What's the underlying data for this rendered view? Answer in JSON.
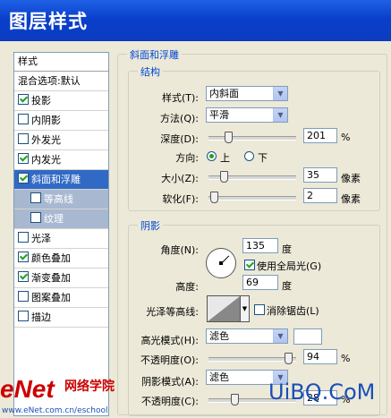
{
  "window": {
    "title": "图层样式"
  },
  "style_list": {
    "header": "样式",
    "blend_options": "混合选项:默认",
    "items": [
      {
        "label": "投影",
        "checked": true,
        "sub": false,
        "selected": false
      },
      {
        "label": "内阴影",
        "checked": false,
        "sub": false,
        "selected": false
      },
      {
        "label": "外发光",
        "checked": false,
        "sub": false,
        "selected": false
      },
      {
        "label": "内发光",
        "checked": true,
        "sub": false,
        "selected": false
      },
      {
        "label": "斜面和浮雕",
        "checked": true,
        "sub": false,
        "selected": true
      },
      {
        "label": "等高线",
        "checked": false,
        "sub": true,
        "selected": false
      },
      {
        "label": "纹理",
        "checked": false,
        "sub": true,
        "selected": false
      },
      {
        "label": "光泽",
        "checked": false,
        "sub": false,
        "selected": false
      },
      {
        "label": "颜色叠加",
        "checked": true,
        "sub": false,
        "selected": false
      },
      {
        "label": "渐变叠加",
        "checked": true,
        "sub": false,
        "selected": false
      },
      {
        "label": "图案叠加",
        "checked": false,
        "sub": false,
        "selected": false
      },
      {
        "label": "描边",
        "checked": false,
        "sub": false,
        "selected": false
      }
    ]
  },
  "bevel": {
    "legend": "斜面和浮雕",
    "structure": {
      "legend": "结构",
      "style_label": "样式(T):",
      "style_value": "内斜面",
      "technique_label": "方法(Q):",
      "technique_value": "平滑",
      "depth_label": "深度(D):",
      "depth_value": "201",
      "depth_unit": "%",
      "depth_fraction": 0.2,
      "direction_label": "方向:",
      "direction_up": "上",
      "direction_down": "下",
      "direction_selected": "up",
      "size_label": "大小(Z):",
      "size_value": "35",
      "size_unit": "像素",
      "size_fraction": 0.14,
      "soften_label": "软化(F):",
      "soften_value": "2",
      "soften_unit": "像素",
      "soften_fraction": 0.02
    },
    "shading": {
      "legend": "阴影",
      "angle_label": "角度(N):",
      "angle_value": "135",
      "angle_unit": "度",
      "global_light_label": "使用全局光(G)",
      "global_light_checked": true,
      "altitude_label": "高度:",
      "altitude_value": "69",
      "altitude_unit": "度",
      "gloss_contour_label": "光泽等高线:",
      "anti_alias_label": "消除锯齿(L)",
      "anti_alias_checked": false,
      "highlight_mode_label": "高光模式(H):",
      "highlight_mode_value": "滤色",
      "highlight_color": "#ffffff",
      "highlight_opacity_label": "不透明度(O):",
      "highlight_opacity_value": "94",
      "highlight_opacity_unit": "%",
      "highlight_opacity_fraction": 0.94,
      "shadow_mode_label": "阴影模式(A):",
      "shadow_mode_value": "滤色",
      "shadow_opacity_label": "不透明度(C):",
      "shadow_opacity_value": "28",
      "shadow_opacity_unit": "%",
      "shadow_opacity_fraction": 0.28
    }
  },
  "watermark": {
    "enet": "eNet",
    "enet_cn": "网络学院",
    "url": "www.eNet.com.cn/eschool",
    "uibq": "UiBQ.CoM"
  },
  "colors": {
    "titlebar": "#0a3fcb",
    "selected": "#316ac5",
    "legend": "#0046d5",
    "watermark_red": "#cc0000",
    "watermark_blue": "#1a4fb8"
  }
}
